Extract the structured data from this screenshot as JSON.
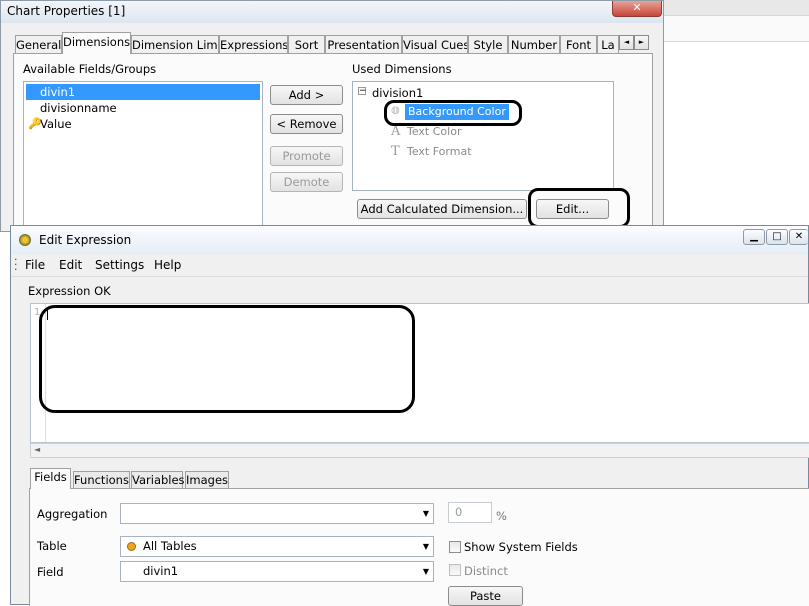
{
  "chart_properties": {
    "title": "Chart Properties [1]",
    "tabs": [
      "General",
      "Dimensions",
      "Dimension Limits",
      "Expressions",
      "Sort",
      "Presentation",
      "Visual Cues",
      "Style",
      "Number",
      "Font",
      "La"
    ],
    "tab_scroll": [
      "◄",
      "►"
    ],
    "available_label": "Available Fields/Groups",
    "available_items": [
      "divin1",
      "divisionname",
      "Value"
    ],
    "used_label": "Used Dimensions",
    "used_tree": {
      "root": "division1",
      "children": [
        "Background Color",
        "Text Color",
        "Text Format"
      ]
    },
    "buttons": {
      "add": "Add >",
      "remove": "< Remove",
      "promote": "Promote",
      "demote": "Demote",
      "add_calculated": "Add Calculated Dimension...",
      "edit": "Edit..."
    }
  },
  "edit_expression": {
    "title": "Edit Expression",
    "menu": [
      "File",
      "Edit",
      "Settings",
      "Help"
    ],
    "status": "Expression OK",
    "line_number": "1",
    "tabs": [
      "Fields",
      "Functions",
      "Variables",
      "Images"
    ],
    "aggregation_label": "Aggregation",
    "aggregation_value": "",
    "number_value": "0",
    "percent": "%",
    "table_label": "Table",
    "table_value": "All Tables",
    "field_label": "Field",
    "field_value": "divin1",
    "show_system_fields": "Show System Fields",
    "distinct": "Distinct",
    "paste": "Paste"
  }
}
